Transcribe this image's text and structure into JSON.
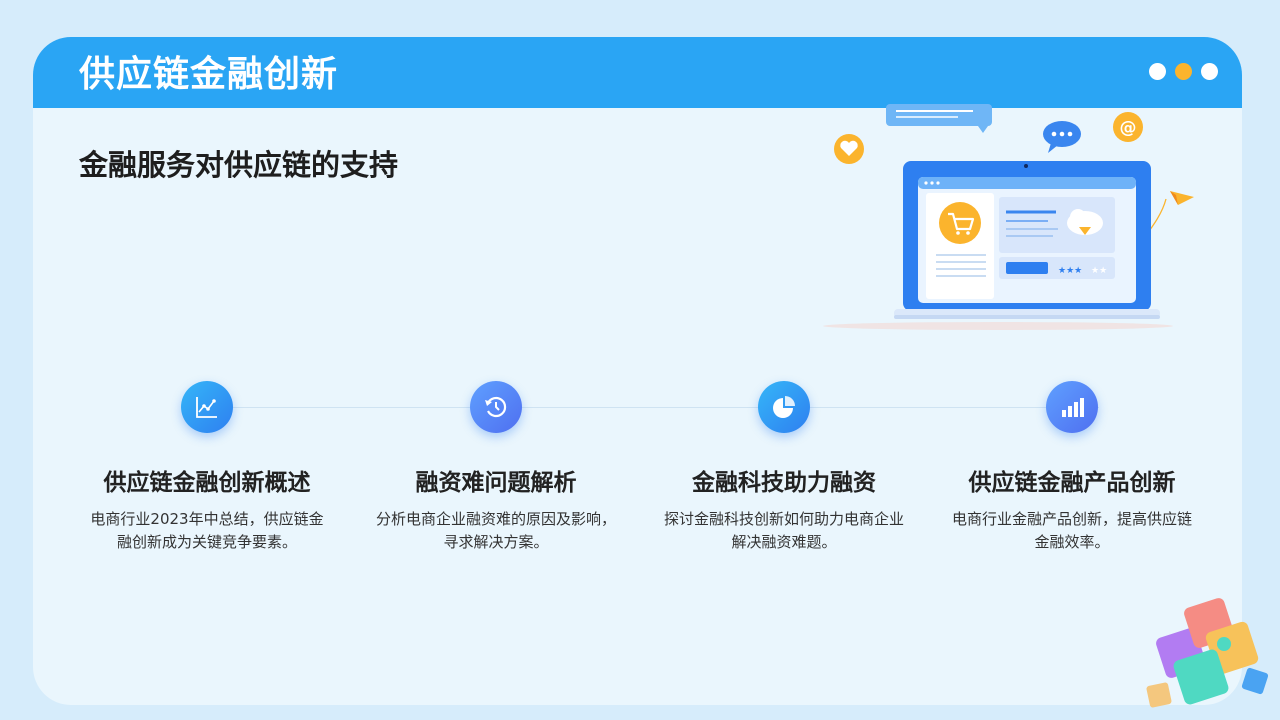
{
  "header": {
    "title": "供应链金融创新"
  },
  "colors": {
    "header": "#2aa5f4",
    "accent_orange": "#fbb42d",
    "accent_blue": "#2e7ff0"
  },
  "section": {
    "subtitle": "金融服务对供应链的支持"
  },
  "window_dots": [
    "#ffffff",
    "#fbb42d",
    "#ffffff"
  ],
  "steps": [
    {
      "icon": "line-chart-icon",
      "title": "供应链金融创新概述",
      "desc": "电商行业2023年中总结，供应链金融创新成为关键竞争要素。"
    },
    {
      "icon": "history-icon",
      "title": "融资难问题解析",
      "desc": "分析电商企业融资难的原因及影响，寻求解决方案。"
    },
    {
      "icon": "pie-chart-icon",
      "title": "金融科技助力融资",
      "desc": "探讨金融科技创新如何助力电商企业解决融资难题。"
    },
    {
      "icon": "bar-chart-icon",
      "title": "供应链金融产品创新",
      "desc": "电商行业金融产品创新，提高供应链金融效率。"
    }
  ],
  "illustration": {
    "at_symbol": "@"
  }
}
